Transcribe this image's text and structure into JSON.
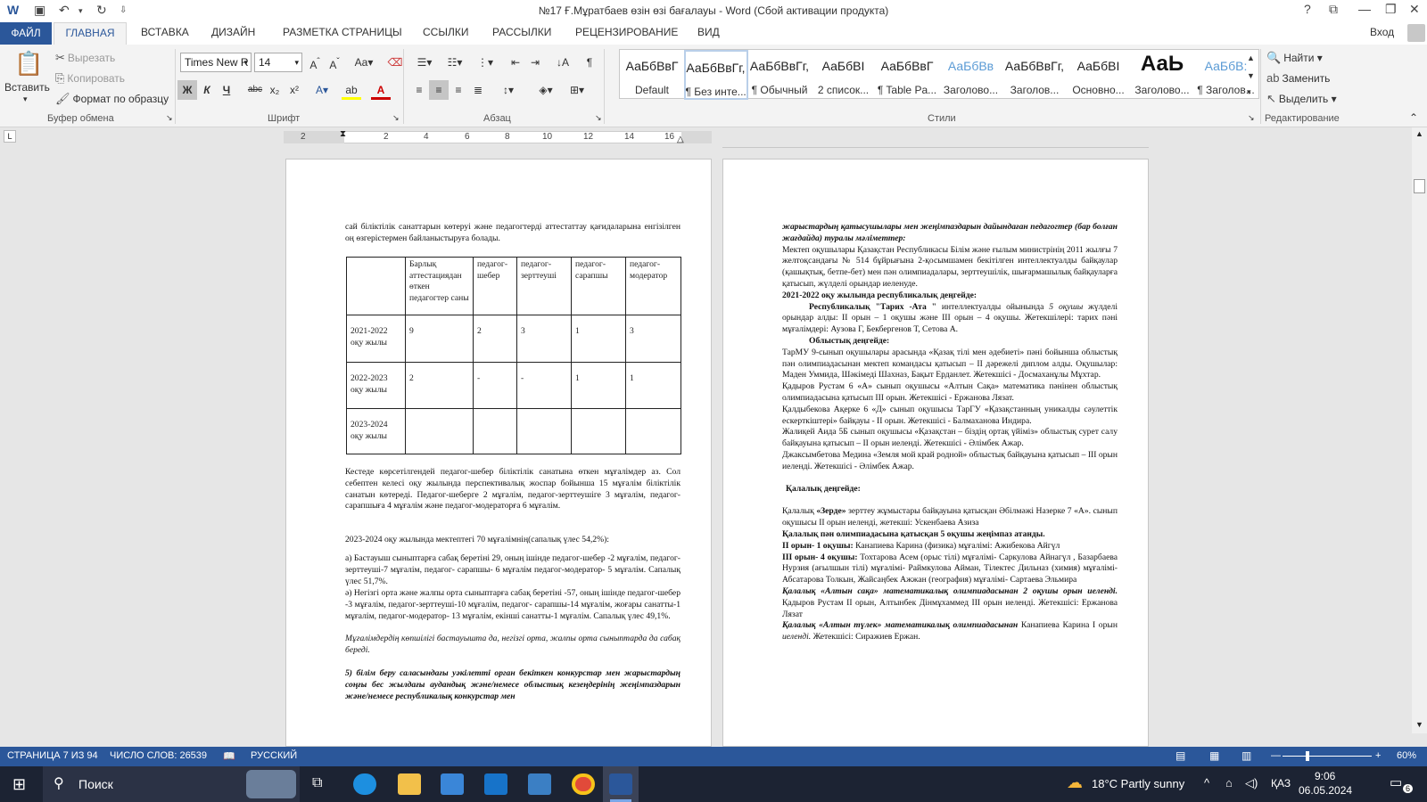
{
  "window": {
    "title": "№17 Ғ.Мұратбаев өзін өзі бағалауы - Word (Сбой активации продукта)",
    "help": "?",
    "login": "Вход"
  },
  "tabs": [
    "ФАЙЛ",
    "ГЛАВНАЯ",
    "ВСТАВКА",
    "ДИЗАЙН",
    "РАЗМЕТКА СТРАНИЦЫ",
    "ССЫЛКИ",
    "РАССЫЛКИ",
    "РЕЦЕНЗИРОВАНИЕ",
    "ВИД"
  ],
  "clipboard": {
    "paste": "Вставить",
    "cut": "Вырезать",
    "copy": "Копировать",
    "format": "Формат по образцу",
    "label": "Буфер обмена"
  },
  "font": {
    "name": "Times New R",
    "size": "14",
    "label": "Шрифт",
    "bold": "Ж",
    "italic": "К",
    "underline": "Ч",
    "strike": "abc",
    "sub": "x₂",
    "sup": "x²"
  },
  "paragraph": {
    "label": "Абзац"
  },
  "styles": {
    "label": "Стили",
    "items": [
      {
        "sample": "АаБбВвГ",
        "name": "Default"
      },
      {
        "sample": "АаБбВвГг,",
        "name": "¶ Без инте..."
      },
      {
        "sample": "АаБбВвГг,",
        "name": "¶ Обычный"
      },
      {
        "sample": "АаБбВІ",
        "name": "2 список..."
      },
      {
        "sample": "АаБбВвГ",
        "name": "¶ Table Pa..."
      },
      {
        "sample": "АаБбВв",
        "name": "Заголово..."
      },
      {
        "sample": "АаБбВвГг,",
        "name": "Заголов..."
      },
      {
        "sample": "АаБбВІ",
        "name": "Основно..."
      },
      {
        "sample": "АаЬ",
        "name": "Заголово..."
      },
      {
        "sample": "АаБбВ:",
        "name": "¶ Заголов..."
      }
    ]
  },
  "editing": {
    "find": "Найти",
    "replace": "Заменить",
    "select": "Выделить",
    "label": "Редактирование"
  },
  "ruler": [
    "2",
    "2",
    "4",
    "6",
    "8",
    "10",
    "12",
    "14",
    "16"
  ],
  "page1": {
    "intro": "сай біліктілік санаттарын көтеруі    және педагогтерді аттестаттау қағидаларына енгізілген оң өзгерістермен байланыстыруға болады.",
    "table": {
      "headers": [
        "",
        "Барлық аттестациядан өткен педагогтер саны",
        "педагог-шебер",
        "педагог-зерттеуші",
        "педагог-сарапшы",
        "педагог-модератор"
      ],
      "rows": [
        [
          "2021-2022 оқу жылы",
          "9",
          "2",
          "3",
          "1",
          "3"
        ],
        [
          "2022-2023 оқу жылы",
          "2",
          "-",
          "-",
          "1",
          "1"
        ],
        [
          "2023-2024 оқу жылы",
          "",
          "",
          "",
          "",
          ""
        ]
      ]
    },
    "p1": "Кестеде көрсетілгендей педагог-шебер біліктілік санатына өткен мұғалімдер аз. Сол себептен келесі оқу жылында перспективалық жоспар бойынша 15 мұғалім біліктілік санатын көтереді. Педагог-шеберге 2 мұғалім, педагог-зерттеушіге 3 мұғалім, педагог-сарапшыға 4 мұғалім және педагог-модераторға 6 мұғалім.",
    "p2": "2023-2024 оқу жылында мектептегі 70 мұғалімнің(сапалық үлес 54,2%):",
    "p3": "а) Бастауыш сыныптарға сабақ беретіні 29, оның ішінде  педагог-шебер -2 мұғалім, педагог-зерттеуші-7 мұғалім, педагог- сарапшы- 6 мұғалім педагог-модератор- 5 мұғалім.  Сапалық үлес 51,7%.",
    "p4": "ә) Негізгі орта  және жалпы орта  сыныптарға сабақ беретіні -57, оның ішінде педагог-шебер -3 мұғалім, педагог-зерттеуші-10 мұғалім, педагог- сарапшы-14 мұғалім, жоғары санатты-1 мұғалім, педагог-модератор- 13 мұғалім, екінші санатты-1 мұғалім.  Сапалық үлес 49,1%.",
    "p5": "Мұғалімдердің көпшілігі бастауышта да, негізгі орта, жалпы орта сыныптарда да сабақ береді.",
    "p6": "5) білім беру саласындағы уәкілетті орган бекіткен конкурстар мен жарыстардың соңғы бес жылдағы аудандық және/немесе облыстық кезеңдерінің жеңімпаздарын және/немесе республикалық конкурстар мен"
  },
  "page2": {
    "l1": "жарыстардың қатысушылары мен жеңімпаздарын дайындаған педагогтер (бар болған жағдайда) туралы мәліметтер:",
    "l2": "Мектеп оқушылары Қазақстан Республикасы Білім және ғылым министрінің 2011 жылғы 7 желтоқсандағы № 514 бұйрығына 2-қосымшамен бекітілген интеллектуалды байқаулар (қашықтық, бетпе-бет) мен пән олимпиадалары, зерттеушілік, шығармашылық байқауларға қатысып, жүлделі орындар иеленуде.",
    "l3": "2021-2022 оқу жылында республикалық  деңгейде:",
    "l4a": "Республикалық \"Тарих -Ата \"",
    "l4b": " интеллектуалды ойынында ",
    "l4c": "5 оқушы",
    "l4d": " жүлделі орындар алды: ІІ орын – 1 оқушы және ІІІ орын – 4 оқушы. Жетекшілері: тарих пәні мұғалімдері: Аузова Г, Бекбергенов Т, Сетова А.",
    "l5": "Облыстық деңгейде:",
    "l6": "ТарМУ 9-сынып оқушылары арасында «Қазақ тілі мен әдебиеті» пәні бойынша облыстық пән олимпиадасынан мектеп командасы қатысып – ІІ дәрежелі диплом алды. Оқушылар: Маден Уммида, Шәкімеді Шахназ, Бақыт Ерданлет.  Жетекшісі - Досмаханұлы Мұхтар.",
    "l7": "Қадыров Рустам 6 «А»  сынып оқушысы «Алтын Сақа» математика пәнінен облыстық олимпиадасына қатысып  ІІІ орын.  Жетекшісі - Ержанова Лязат.",
    "l8": "Қалдыбекова Ақерке  6 «Д» сынып оқушысы    ТарГУ «Қазақстанның уникалды сәулеттік ескерткіштері» байқауы - ІІ орын.  Жетекшісі - Балмаханова Индира.",
    "l9": "Жалиқей Аида 5Б сынып оқушысы   «Қазақстан – біздің ортақ үйіміз» облыстық сурет салу байқауына қатысып  – ІІ орын иеленді. Жетекшісі - Әлімбек Ажар.",
    "l10": "Джаксымбетова Медина  «Земля мой край родной» облыстық байқауына қатысып – ІІІ орын иеленді. Жетекшісі - Әлімбек Ажар.",
    "l11": "Қалалық деңгейде:",
    "l12a": "Қалалық ",
    "l12b": "«Зерде»",
    "l12c": " зерттеу жұмыстары байқауына қатысқан Әбілмәжі Назерке 7 «А». сынып оқушысы ІІ орын иеленді, жетекші: Ускенбаева Азиза",
    "l13": "Қалалық пән олимпиадасына  қатысқан 5  оқушы жеңімпаз атанды.",
    "l14a": "ІІ орын- 1 оқушы:",
    "l14b": " Канапиева Карина  (физика) мұғалімі: Ажибекова Айгүл",
    "l15a": "ІІІ орын- 4 оқушы:",
    "l15b": " Тохтарова Асем (орыс тілі)  мұғалімі- Саркулова Айнагүл , Базарбаева Нурзия  (ағылшын тілі) мұғалімі- Раймкулова Айман,  Тілектес Дильназ  (химия)  мұғалімі-  Абсатарова Толкын,  Жайсаңбек Ажжан (география) мұғалімі-  Сартаева Эльмира",
    "l16a": "Қалалық «Алтын сақа» математикалық олимпиадасынан  2 оқушы орын иеленді.",
    "l16b": " Қадыров Рустам ІІ орын, Алтынбек Дінмұхаммед  ІІІ орын иеленді. Жетекшісі: Ержанова Лязат",
    "l17a": "Қалалық «Алтын түлек»  математикалық олимпиадасынан",
    "l17b": " Канапиева Карина І орын  ",
    "l17c": "иеленді.",
    "l17d": " Жетекшісі: Сиражиев Ержан."
  },
  "status": {
    "page": "СТРАНИЦА 7 ИЗ 94",
    "words": "ЧИСЛО СЛОВ: 26539",
    "lang": "РУССКИЙ",
    "zoom": "60%"
  },
  "taskbar": {
    "search": "Поиск",
    "weather": "18°C  Partly sunny",
    "lang": "ҚАЗ",
    "time": "9:06",
    "date": "06.05.2024",
    "notif": "6"
  }
}
